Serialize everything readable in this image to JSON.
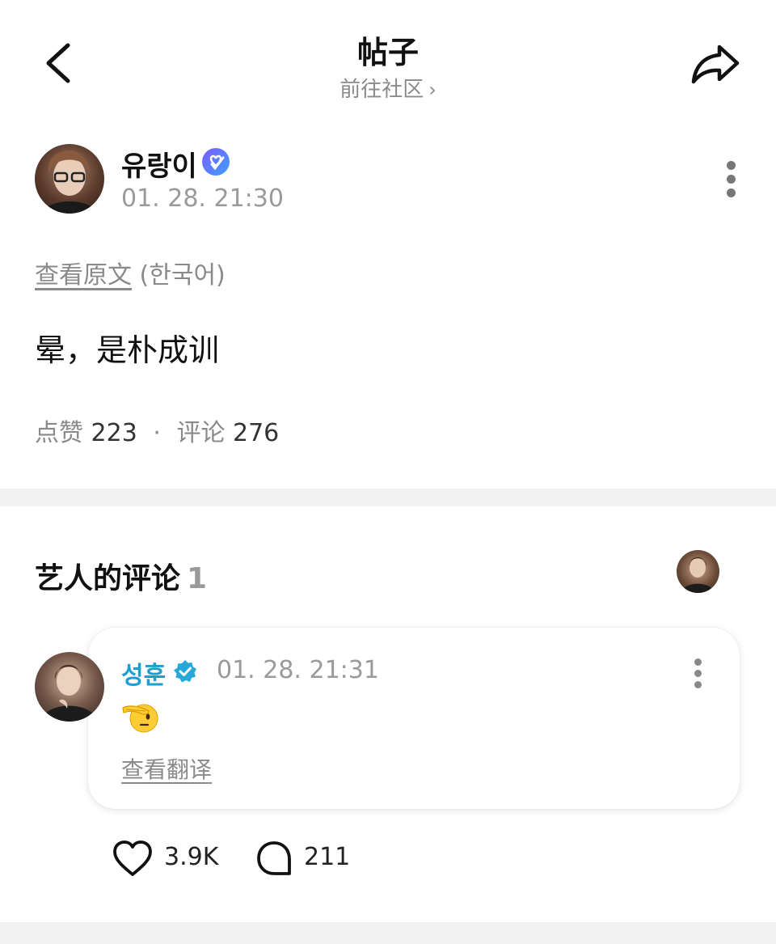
{
  "header": {
    "title": "帖子",
    "subtitle": "前往社区",
    "subtitle_chevron": "›"
  },
  "post": {
    "author": "유랑이",
    "timestamp": "01. 28. 21:30",
    "view_original_label": "查看原文",
    "original_language": "(한국어)",
    "body": "晕，是朴成训",
    "likes_label": "点赞",
    "likes_count": "223",
    "separator": "·",
    "comments_label": "评论",
    "comments_count": "276"
  },
  "artist_comments": {
    "title": "艺人的评论",
    "count": "1"
  },
  "comment": {
    "author": "성훈",
    "timestamp": "01. 28. 21:31",
    "emoji": "saluting-face",
    "view_translation_label": "查看翻译",
    "like_count": "3.9K",
    "reply_count": "211"
  },
  "colors": {
    "artist_name": "#1c9ed0",
    "muted_text": "#8a8a8a",
    "section_bg": "#f2f2f2"
  }
}
